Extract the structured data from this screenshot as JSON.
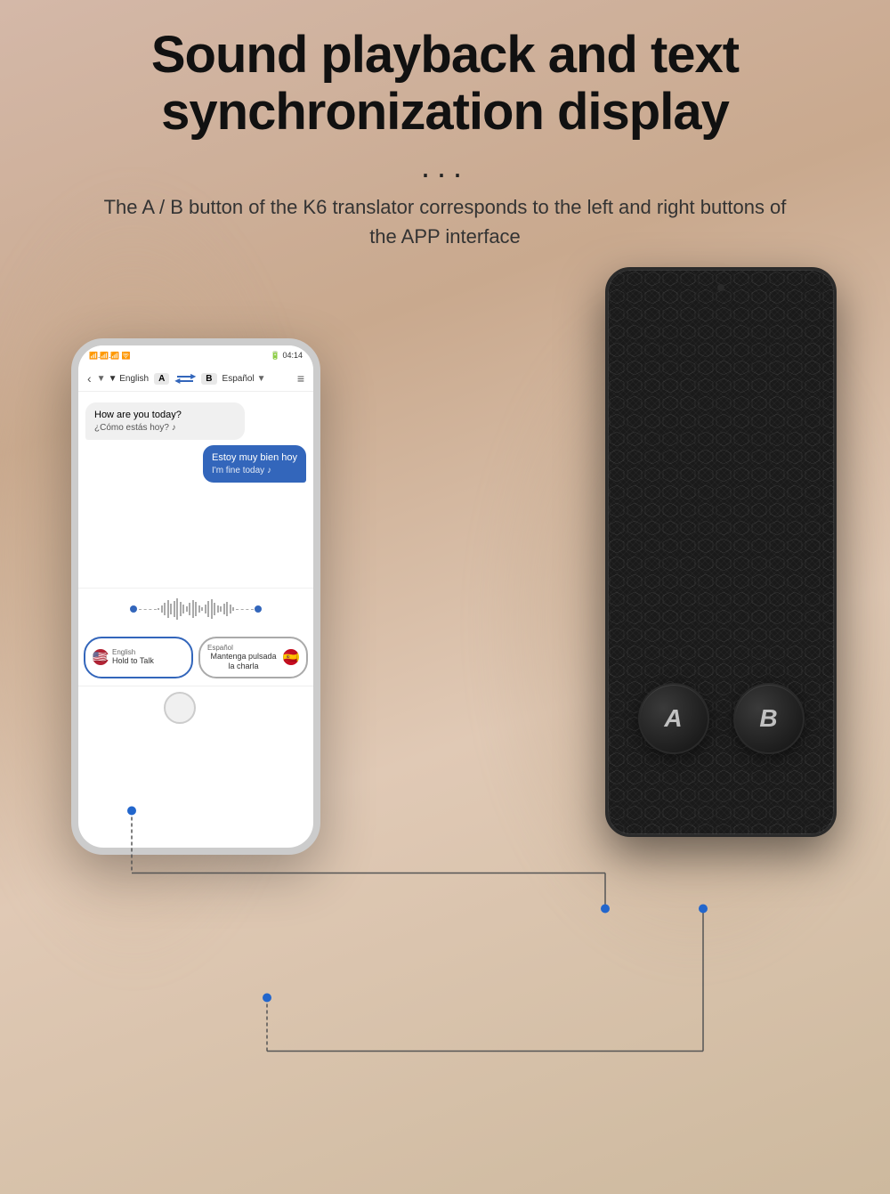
{
  "header": {
    "title_line1": "Sound playback and text",
    "title_line2": "synchronization display",
    "dots": "...",
    "subtitle": "The A / B button of the K6 translator corresponds to the left and right buttons of the APP interface"
  },
  "phone": {
    "status_bar": {
      "left": "📶📶📶📶 🛜",
      "right": "🔋 04:14"
    },
    "topbar": {
      "back": "‹",
      "lang_a_label": "▼ English",
      "lang_a_badge": "A",
      "swap": "⇄",
      "lang_b_badge": "B",
      "lang_b_label": "Español ▼",
      "menu": "≡"
    },
    "messages": [
      {
        "side": "left",
        "text": "How are you today?",
        "translation": "¿Cómo estás hoy? ♪"
      },
      {
        "side": "right",
        "text": "Estoy muy bien hoy",
        "translation": "I'm fine today ♪"
      }
    ],
    "buttons": {
      "a_lang": "English",
      "a_action": "Hold to Talk",
      "b_lang": "Español",
      "b_action": "Mantenga pulsada la charla"
    }
  },
  "device": {
    "btn_a": "A",
    "btn_b": "B"
  },
  "colors": {
    "accent_blue": "#3366bb",
    "device_dark": "#1a1a1a",
    "text_primary": "#111111",
    "text_secondary": "#444444"
  }
}
